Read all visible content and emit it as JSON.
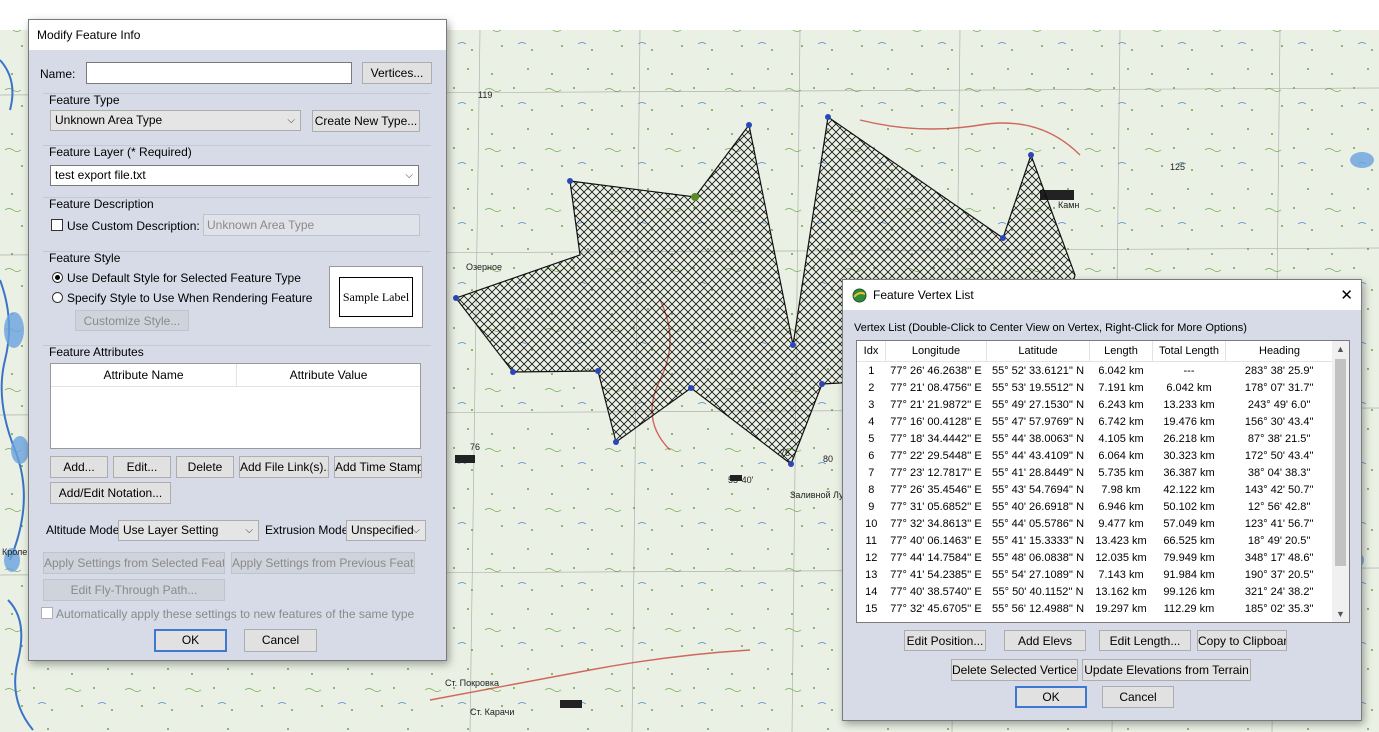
{
  "modify_dialog": {
    "title": "Modify Feature Info",
    "name_label": "Name:",
    "name_value": "",
    "vertices_button": "Vertices...",
    "feature_type_label": "Feature Type",
    "feature_type_value": "Unknown Area Type",
    "create_new_type_button": "Create New Type...",
    "feature_layer_label": "Feature Layer (* Required)",
    "feature_layer_value": "test export file.txt",
    "feature_description_label": "Feature Description",
    "use_custom_description_label": "Use Custom Description:",
    "custom_description_value": "Unknown Area Type",
    "feature_style_label": "Feature Style",
    "radio_default_style": "Use Default Style for Selected Feature Type",
    "radio_specify_style": "Specify Style to Use When Rendering Feature",
    "customize_style_button": "Customize Style...",
    "sample_label": "Sample Label",
    "feature_attributes_label": "Feature Attributes",
    "attr_col_name": "Attribute Name",
    "attr_col_value": "Attribute Value",
    "add_button": "Add...",
    "edit_button": "Edit...",
    "delete_button": "Delete",
    "add_file_link_button": "Add File Link(s)...",
    "add_time_stamp_button": "Add Time Stamp",
    "add_edit_notation_button": "Add/Edit Notation...",
    "altitude_mode_label": "Altitude Mode:",
    "altitude_mode_value": "Use Layer Setting",
    "extrusion_mode_label": "Extrusion Mode:",
    "extrusion_mode_value": "Unspecified",
    "apply_selected_button": "Apply Settings from Selected Feature",
    "apply_previous_button": "Apply Settings from Previous Feature",
    "edit_flythrough_button": "Edit Fly-Through Path...",
    "auto_apply_label": "Automatically apply these settings to new features of the same type",
    "ok_button": "OK",
    "cancel_button": "Cancel"
  },
  "vertex_dialog": {
    "title": "Feature Vertex List",
    "close_glyph": "✕",
    "instruction": "Vertex List (Double-Click to Center View on Vertex, Right-Click for More Options)",
    "columns": [
      "Idx",
      "Longitude",
      "Latitude",
      "Length",
      "Total Length",
      "Heading"
    ],
    "rows": [
      [
        "1",
        "77° 26' 46.2638'' E",
        "55° 52' 33.6121'' N",
        "6.042 km",
        "---",
        "283° 38' 25.9''"
      ],
      [
        "2",
        "77° 21' 08.4756'' E",
        "55° 53' 19.5512'' N",
        "7.191 km",
        "6.042 km",
        "178° 07' 31.7''"
      ],
      [
        "3",
        "77° 21' 21.9872'' E",
        "55° 49' 27.1530'' N",
        "6.243 km",
        "13.233 km",
        "243° 49' 6.0''"
      ],
      [
        "4",
        "77° 16' 00.4128'' E",
        "55° 47' 57.9769'' N",
        "6.742 km",
        "19.476 km",
        "156° 30' 43.4''"
      ],
      [
        "5",
        "77° 18' 34.4442'' E",
        "55° 44' 38.0063'' N",
        "4.105 km",
        "26.218 km",
        "87° 38' 21.5''"
      ],
      [
        "6",
        "77° 22' 29.5448'' E",
        "55° 44' 43.4109'' N",
        "6.064 km",
        "30.323 km",
        "172° 50' 43.4''"
      ],
      [
        "7",
        "77° 23' 12.7817'' E",
        "55° 41' 28.8449'' N",
        "5.735 km",
        "36.387 km",
        "38° 04' 38.3''"
      ],
      [
        "8",
        "77° 26' 35.4546'' E",
        "55° 43' 54.7694'' N",
        "7.98 km",
        "42.122 km",
        "143° 42' 50.7''"
      ],
      [
        "9",
        "77° 31' 05.6852'' E",
        "55° 40' 26.6918'' N",
        "6.946 km",
        "50.102 km",
        "12° 56' 42.8''"
      ],
      [
        "10",
        "77° 32' 34.8613'' E",
        "55° 44' 05.5786'' N",
        "9.477 km",
        "57.049 km",
        "123° 41' 56.7''"
      ],
      [
        "11",
        "77° 40' 06.1463'' E",
        "55° 41' 15.3333'' N",
        "13.423 km",
        "66.525 km",
        "18° 49' 20.5''"
      ],
      [
        "12",
        "77° 44' 14.7584'' E",
        "55° 48' 06.0838'' N",
        "12.035 km",
        "79.949 km",
        "348° 17' 48.6''"
      ],
      [
        "13",
        "77° 41' 54.2385'' E",
        "55° 54' 27.1089'' N",
        "7.143 km",
        "91.984 km",
        "190° 37' 20.5''"
      ],
      [
        "14",
        "77° 40' 38.5740'' E",
        "55° 50' 40.1152'' N",
        "13.162 km",
        "99.126 km",
        "321° 24' 38.2''"
      ],
      [
        "15",
        "77° 32' 45.6705'' E",
        "55° 56' 12.4988'' N",
        "19.297 km",
        "112.29 km",
        "185° 02' 35.3''"
      ]
    ],
    "edit_position_button": "Edit Position...",
    "add_elevs_button": "Add Elevs",
    "edit_length_button": "Edit Length...",
    "copy_clipboard_button": "Copy to Clipboard",
    "delete_selected_button": "Delete Selected Vertices",
    "update_elevations_button": "Update Elevations from Terrain",
    "ok_button": "OK",
    "cancel_button": "Cancel"
  },
  "map": {
    "labels": [
      "119",
      "125",
      "Камн",
      "76",
      "80",
      "76",
      "55°40'",
      "Заливной Луг",
      "Ст. Карачи",
      "Ст. Покровка",
      "Озерное",
      "Кролево"
    ],
    "accent_colors": {
      "map_bg": "#e9efe2",
      "water": "#3a74c8",
      "polygon_stroke": "#111111",
      "vertex": "#2a46b8"
    }
  }
}
